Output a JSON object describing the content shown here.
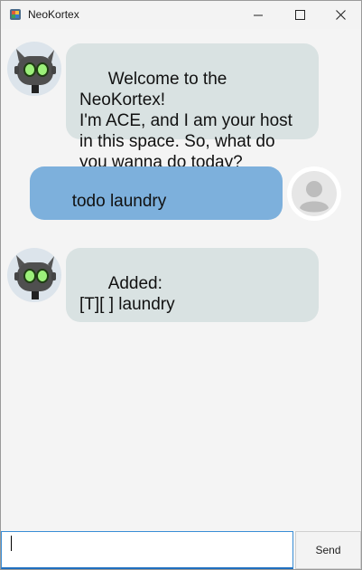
{
  "window": {
    "title": "NeoKortex",
    "icons": [
      "app-icon",
      "minimize-icon",
      "maximize-icon",
      "close-icon"
    ]
  },
  "messages": [
    {
      "sender": "bot",
      "avatar": "robot-avatar-icon",
      "text": "Welcome to the NeoKortex!\nI'm ACE, and I am your host\nin this space. So, what do\nyou wanna do today?"
    },
    {
      "sender": "user",
      "avatar": "user-avatar-icon",
      "text": "todo laundry"
    },
    {
      "sender": "bot",
      "avatar": "robot-avatar-icon",
      "text": "Added:\n[T][ ] laundry"
    }
  ],
  "input": {
    "value": "",
    "placeholder": ""
  },
  "send_button": {
    "label": "Send"
  },
  "colors": {
    "bot_bubble": "#d9e2e2",
    "user_bubble": "#7db0dc",
    "input_focus": "#1f6fbf"
  }
}
